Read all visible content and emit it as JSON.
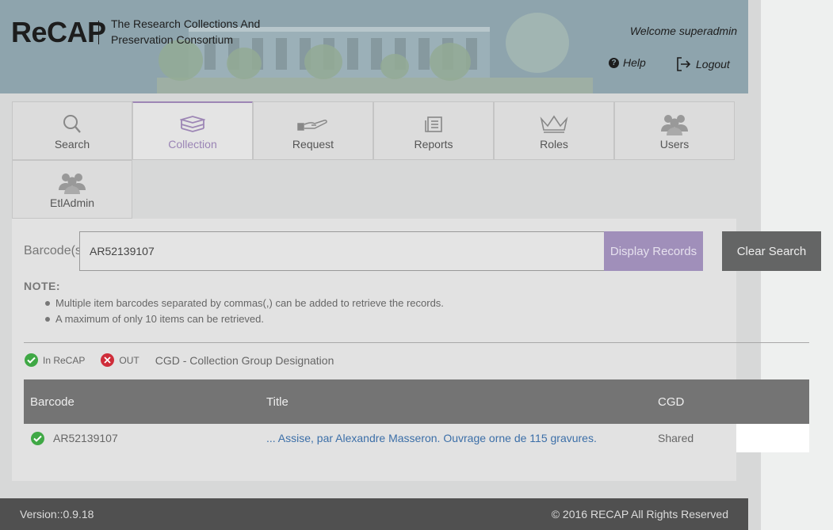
{
  "header": {
    "logo": "ReCAP",
    "tagline": "The Research Collections And Preservation Consortium",
    "welcome": "Welcome superadmin",
    "help_label": "Help",
    "logout_label": "Logout"
  },
  "tabs": [
    {
      "label": "Search",
      "icon": "search-icon"
    },
    {
      "label": "Collection",
      "icon": "books-icon",
      "active": true
    },
    {
      "label": "Request",
      "icon": "hand-icon"
    },
    {
      "label": "Reports",
      "icon": "reports-icon"
    },
    {
      "label": "Roles",
      "icon": "crown-icon"
    },
    {
      "label": "Users",
      "icon": "users-icon"
    },
    {
      "label": "EtlAdmin",
      "icon": "users-icon"
    }
  ],
  "search": {
    "label": "Barcode(s)",
    "value": "AR52139107",
    "display_button": "Display Records",
    "clear_button": "Clear Search"
  },
  "note": {
    "title": "NOTE:",
    "items": [
      "Multiple item barcodes separated by commas(,) can be added to retrieve the records.",
      "A maximum of only 10 items can be retrieved."
    ]
  },
  "legend": {
    "in_recap": "In ReCAP",
    "out": "OUT",
    "cgd": "CGD - Collection Group Designation"
  },
  "table": {
    "headers": [
      "Barcode",
      "Title",
      "CGD"
    ],
    "rows": [
      {
        "barcode": "AR52139107",
        "title": "... Assise, par Alexandre Masseron. Ouvrage orne de 115 gravures.",
        "cgd": "Shared",
        "status": "in"
      }
    ]
  },
  "footer": {
    "version": "Version::0.9.18",
    "copyright": "© 2016 RECAP All Rights Reserved"
  },
  "colors": {
    "header_bg": "#8ea4ad",
    "accent": "#a08fba",
    "green": "#3fa845",
    "red": "#cf2d3a",
    "link": "#3c6fa8"
  }
}
